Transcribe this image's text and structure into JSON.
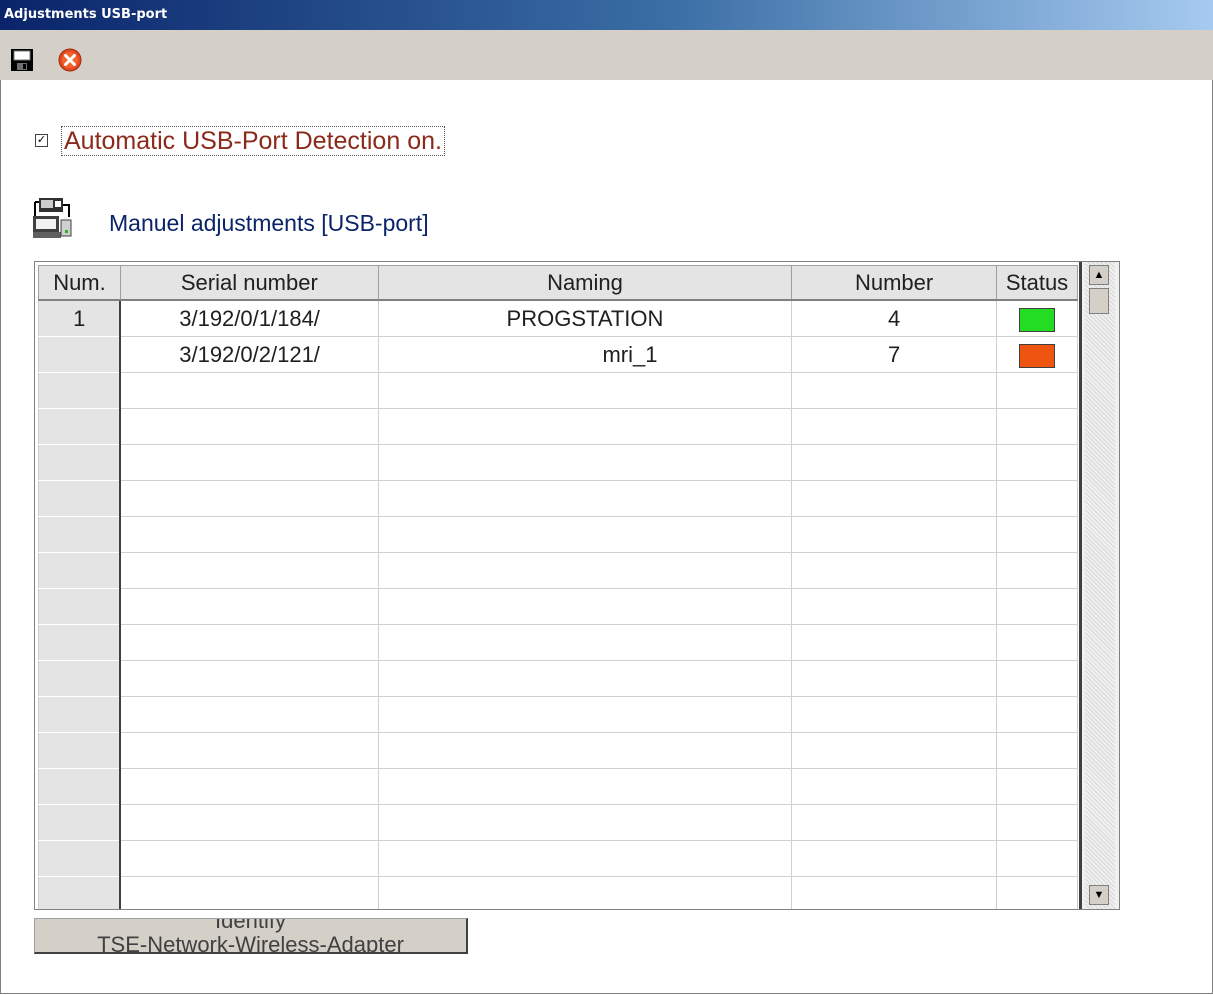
{
  "window": {
    "title": "Adjustments USB-port"
  },
  "toolbar": {
    "save_icon": "save-icon",
    "close_icon": "close-icon"
  },
  "auto_detect": {
    "checked": true,
    "label": "Automatic USB-Port Detection on."
  },
  "section": {
    "icon": "usb-device-icon",
    "title": "Manuel adjustments [USB-port]"
  },
  "table": {
    "columns": [
      "Num.",
      "Serial number",
      "Naming",
      "Number",
      "Status"
    ],
    "rows": [
      {
        "num": "1",
        "serial": "3/192/0/1/184/",
        "naming": "PROGSTATION",
        "number": "4",
        "status_color": "#22dd22"
      },
      {
        "num": "",
        "serial": "3/192/0/2/121/",
        "naming": "mri_1",
        "number": "7",
        "status_color": "#ee5511"
      }
    ],
    "empty_rows": 15
  },
  "identify_button": {
    "line1": "Identify",
    "line2": "TSE-Network-Wireless-Adapter"
  }
}
